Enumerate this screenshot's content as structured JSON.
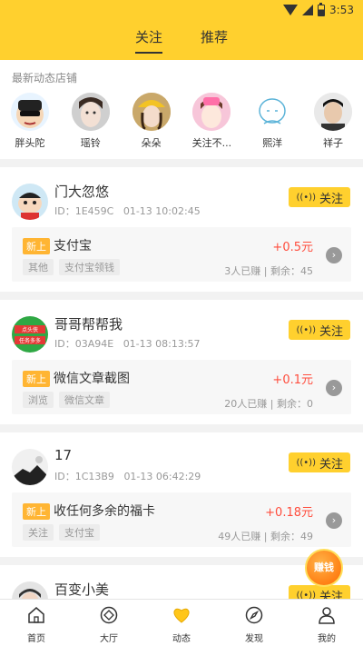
{
  "status": {
    "time": "3:53"
  },
  "tabs": [
    {
      "label": "关注",
      "active": true
    },
    {
      "label": "推荐",
      "active": false
    }
  ],
  "recent": {
    "title": "最新动态店铺",
    "shops": [
      {
        "name": "胖头陀"
      },
      {
        "name": "瑶铃"
      },
      {
        "name": "朵朵"
      },
      {
        "name": "关注不..."
      },
      {
        "name": "熙洋"
      },
      {
        "name": "祥子"
      }
    ]
  },
  "cards": [
    {
      "name": "门大忽悠",
      "id": "ID：1E459C",
      "time": "01-13 10:02:45",
      "follow": "关注",
      "badge": "新上",
      "task": "支付宝",
      "price": "+0.5元",
      "tags": [
        "其他",
        "支付宝领钱"
      ],
      "stats": "3人已赚 | 剩余：45"
    },
    {
      "name": "哥哥帮帮我",
      "id": "ID：03A94E",
      "time": "01-13 08:13:57",
      "follow": "关注",
      "badge": "新上",
      "task": "微信文章截图",
      "price": "+0.1元",
      "tags": [
        "浏览",
        "微信文章"
      ],
      "stats": "20人已赚 | 剩余：0"
    },
    {
      "name": "17",
      "id": "ID：1C13B9",
      "time": "01-13 06:42:29",
      "follow": "关注",
      "badge": "新上",
      "task": "收任何多余的福卡",
      "price": "+0.18元",
      "tags": [
        "关注",
        "支付宝"
      ],
      "stats": "49人已赚 | 剩余：49"
    },
    {
      "name": "百变小美",
      "follow": "关注"
    }
  ],
  "coin": {
    "label": "赚钱"
  },
  "nav": [
    {
      "label": "首页",
      "icon": "home-icon"
    },
    {
      "label": "大厅",
      "icon": "hall-icon"
    },
    {
      "label": "动态",
      "icon": "feed-icon"
    },
    {
      "label": "发现",
      "icon": "discover-icon"
    },
    {
      "label": "我的",
      "icon": "user-icon"
    }
  ]
}
